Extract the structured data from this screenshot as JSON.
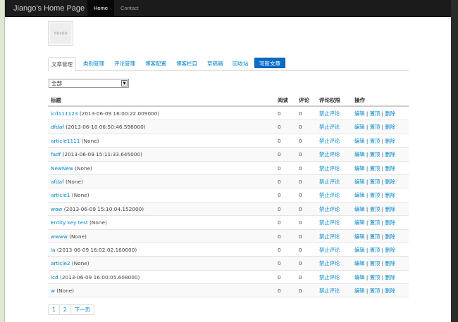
{
  "navbar": {
    "brand": "Jiango's Home Page",
    "items": [
      {
        "label": "Home",
        "active": true
      },
      {
        "label": "Contact",
        "active": false
      }
    ]
  },
  "avatar": {
    "text": "60x60"
  },
  "tabs": [
    {
      "label": "文章管理",
      "active": true
    },
    {
      "label": "类别管理"
    },
    {
      "label": "评论管理"
    },
    {
      "label": "博客配置"
    },
    {
      "label": "博客栏目"
    },
    {
      "label": "草稿箱"
    },
    {
      "label": "回收站"
    }
  ],
  "new_article_button": "写新文章",
  "category_filter": {
    "selected": "全部"
  },
  "table": {
    "headers": {
      "title": "标题",
      "reads": "阅读",
      "comments": "评论",
      "permission": "评论权限",
      "actions": "操作"
    },
    "rows": [
      {
        "title": "lcd111123",
        "date": "(2013-06-09 16:00:22.009000)",
        "reads": "0",
        "comments": "0",
        "perm": "禁止评论",
        "edit": "编辑",
        "top": "置顶",
        "del": "删除"
      },
      {
        "title": "dfdaf",
        "date": "(2013-06-10 06:50:46.598000)",
        "reads": "0",
        "comments": "0",
        "perm": "禁止评论",
        "edit": "编辑",
        "top": "置顶",
        "del": "删除"
      },
      {
        "title": "article1111",
        "date": "(None)",
        "reads": "0",
        "comments": "0",
        "perm": "禁止评论",
        "edit": "编辑",
        "top": "置顶",
        "del": "删除"
      },
      {
        "title": "fadf",
        "date": "(2013-06-09 15:11:33.645000)",
        "reads": "0",
        "comments": "0",
        "perm": "禁止评论",
        "edit": "编辑",
        "top": "置顶",
        "del": "删除"
      },
      {
        "title": "NewNew",
        "date": "(None)",
        "reads": "0",
        "comments": "0",
        "perm": "禁止评论",
        "edit": "编辑",
        "top": "置顶",
        "del": "删除"
      },
      {
        "title": "afdaf",
        "date": "(None)",
        "reads": "0",
        "comments": "0",
        "perm": "禁止评论",
        "edit": "编辑",
        "top": "置顶",
        "del": "删除"
      },
      {
        "title": "article1",
        "date": "(None)",
        "reads": "0",
        "comments": "0",
        "perm": "禁止评论",
        "edit": "编辑",
        "top": "置顶",
        "del": "删除"
      },
      {
        "title": "wow",
        "date": "(2013-06-09 15:10:04.152000)",
        "reads": "0",
        "comments": "0",
        "perm": "禁止评论",
        "edit": "编辑",
        "top": "置顶",
        "del": "删除"
      },
      {
        "title": "Entity key test",
        "date": "(None)",
        "reads": "0",
        "comments": "0",
        "perm": "禁止评论",
        "edit": "编辑",
        "top": "置顶",
        "del": "删除"
      },
      {
        "title": "wwww",
        "date": "(None)",
        "reads": "0",
        "comments": "0",
        "perm": "禁止评论",
        "edit": "编辑",
        "top": "置顶",
        "del": "删除"
      },
      {
        "title": "la",
        "date": "(2013-06-09 16:02:02.160000)",
        "reads": "0",
        "comments": "0",
        "perm": "禁止评论",
        "edit": "编辑",
        "top": "置顶",
        "del": "删除"
      },
      {
        "title": "article2",
        "date": "(None)",
        "reads": "0",
        "comments": "0",
        "perm": "禁止评论",
        "edit": "编辑",
        "top": "置顶",
        "del": "删除"
      },
      {
        "title": "lcd",
        "date": "(2013-06-09 16:00:05.608000)",
        "reads": "0",
        "comments": "0",
        "perm": "禁止评论",
        "edit": "编辑",
        "top": "置顶",
        "del": "删除"
      },
      {
        "title": "w",
        "date": "(None)",
        "reads": "0",
        "comments": "0",
        "perm": "禁止评论",
        "edit": "编辑",
        "top": "置顶",
        "del": "删除"
      }
    ]
  },
  "pagination": [
    "1",
    "2",
    "下一页"
  ]
}
